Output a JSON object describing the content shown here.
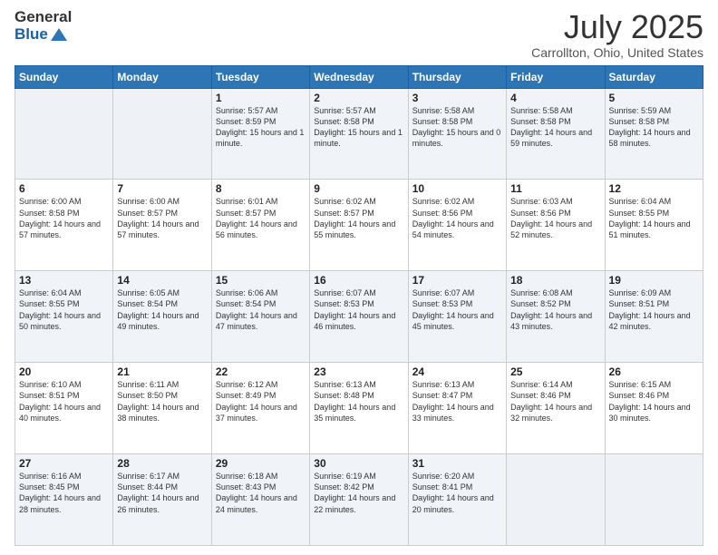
{
  "header": {
    "logo_general": "General",
    "logo_blue": "Blue",
    "title": "July 2025",
    "subtitle": "Carrollton, Ohio, United States"
  },
  "days_of_week": [
    "Sunday",
    "Monday",
    "Tuesday",
    "Wednesday",
    "Thursday",
    "Friday",
    "Saturday"
  ],
  "weeks": [
    [
      {
        "day": "",
        "info": ""
      },
      {
        "day": "",
        "info": ""
      },
      {
        "day": "1",
        "info": "Sunrise: 5:57 AM\nSunset: 8:59 PM\nDaylight: 15 hours\nand 1 minute."
      },
      {
        "day": "2",
        "info": "Sunrise: 5:57 AM\nSunset: 8:58 PM\nDaylight: 15 hours\nand 1 minute."
      },
      {
        "day": "3",
        "info": "Sunrise: 5:58 AM\nSunset: 8:58 PM\nDaylight: 15 hours\nand 0 minutes."
      },
      {
        "day": "4",
        "info": "Sunrise: 5:58 AM\nSunset: 8:58 PM\nDaylight: 14 hours\nand 59 minutes."
      },
      {
        "day": "5",
        "info": "Sunrise: 5:59 AM\nSunset: 8:58 PM\nDaylight: 14 hours\nand 58 minutes."
      }
    ],
    [
      {
        "day": "6",
        "info": "Sunrise: 6:00 AM\nSunset: 8:58 PM\nDaylight: 14 hours\nand 57 minutes."
      },
      {
        "day": "7",
        "info": "Sunrise: 6:00 AM\nSunset: 8:57 PM\nDaylight: 14 hours\nand 57 minutes."
      },
      {
        "day": "8",
        "info": "Sunrise: 6:01 AM\nSunset: 8:57 PM\nDaylight: 14 hours\nand 56 minutes."
      },
      {
        "day": "9",
        "info": "Sunrise: 6:02 AM\nSunset: 8:57 PM\nDaylight: 14 hours\nand 55 minutes."
      },
      {
        "day": "10",
        "info": "Sunrise: 6:02 AM\nSunset: 8:56 PM\nDaylight: 14 hours\nand 54 minutes."
      },
      {
        "day": "11",
        "info": "Sunrise: 6:03 AM\nSunset: 8:56 PM\nDaylight: 14 hours\nand 52 minutes."
      },
      {
        "day": "12",
        "info": "Sunrise: 6:04 AM\nSunset: 8:55 PM\nDaylight: 14 hours\nand 51 minutes."
      }
    ],
    [
      {
        "day": "13",
        "info": "Sunrise: 6:04 AM\nSunset: 8:55 PM\nDaylight: 14 hours\nand 50 minutes."
      },
      {
        "day": "14",
        "info": "Sunrise: 6:05 AM\nSunset: 8:54 PM\nDaylight: 14 hours\nand 49 minutes."
      },
      {
        "day": "15",
        "info": "Sunrise: 6:06 AM\nSunset: 8:54 PM\nDaylight: 14 hours\nand 47 minutes."
      },
      {
        "day": "16",
        "info": "Sunrise: 6:07 AM\nSunset: 8:53 PM\nDaylight: 14 hours\nand 46 minutes."
      },
      {
        "day": "17",
        "info": "Sunrise: 6:07 AM\nSunset: 8:53 PM\nDaylight: 14 hours\nand 45 minutes."
      },
      {
        "day": "18",
        "info": "Sunrise: 6:08 AM\nSunset: 8:52 PM\nDaylight: 14 hours\nand 43 minutes."
      },
      {
        "day": "19",
        "info": "Sunrise: 6:09 AM\nSunset: 8:51 PM\nDaylight: 14 hours\nand 42 minutes."
      }
    ],
    [
      {
        "day": "20",
        "info": "Sunrise: 6:10 AM\nSunset: 8:51 PM\nDaylight: 14 hours\nand 40 minutes."
      },
      {
        "day": "21",
        "info": "Sunrise: 6:11 AM\nSunset: 8:50 PM\nDaylight: 14 hours\nand 38 minutes."
      },
      {
        "day": "22",
        "info": "Sunrise: 6:12 AM\nSunset: 8:49 PM\nDaylight: 14 hours\nand 37 minutes."
      },
      {
        "day": "23",
        "info": "Sunrise: 6:13 AM\nSunset: 8:48 PM\nDaylight: 14 hours\nand 35 minutes."
      },
      {
        "day": "24",
        "info": "Sunrise: 6:13 AM\nSunset: 8:47 PM\nDaylight: 14 hours\nand 33 minutes."
      },
      {
        "day": "25",
        "info": "Sunrise: 6:14 AM\nSunset: 8:46 PM\nDaylight: 14 hours\nand 32 minutes."
      },
      {
        "day": "26",
        "info": "Sunrise: 6:15 AM\nSunset: 8:46 PM\nDaylight: 14 hours\nand 30 minutes."
      }
    ],
    [
      {
        "day": "27",
        "info": "Sunrise: 6:16 AM\nSunset: 8:45 PM\nDaylight: 14 hours\nand 28 minutes."
      },
      {
        "day": "28",
        "info": "Sunrise: 6:17 AM\nSunset: 8:44 PM\nDaylight: 14 hours\nand 26 minutes."
      },
      {
        "day": "29",
        "info": "Sunrise: 6:18 AM\nSunset: 8:43 PM\nDaylight: 14 hours\nand 24 minutes."
      },
      {
        "day": "30",
        "info": "Sunrise: 6:19 AM\nSunset: 8:42 PM\nDaylight: 14 hours\nand 22 minutes."
      },
      {
        "day": "31",
        "info": "Sunrise: 6:20 AM\nSunset: 8:41 PM\nDaylight: 14 hours\nand 20 minutes."
      },
      {
        "day": "",
        "info": ""
      },
      {
        "day": "",
        "info": ""
      }
    ]
  ]
}
